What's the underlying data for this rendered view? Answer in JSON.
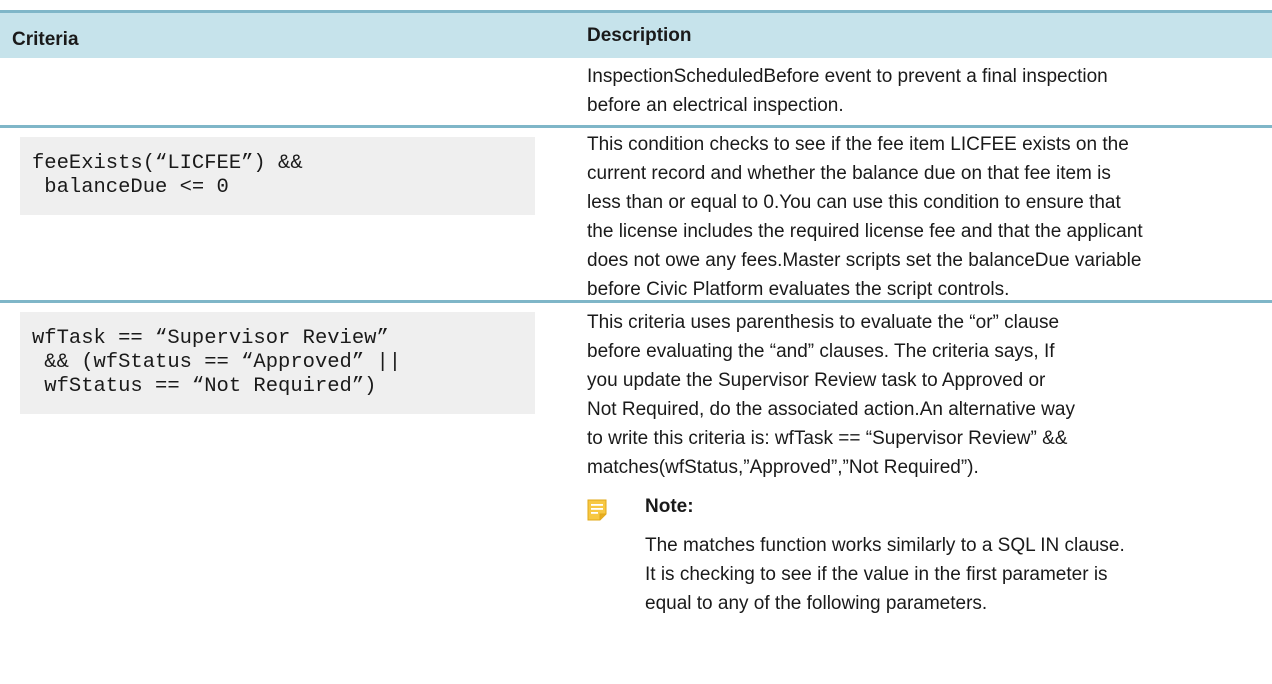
{
  "header": {
    "criteria_label": "Criteria",
    "description_label": "Description"
  },
  "rows": [
    {
      "criteria_code": "",
      "description_lines": [
        "InspectionScheduledBefore event to prevent a final inspection",
        "before an electrical inspection."
      ]
    },
    {
      "criteria_code": "feeExists(“LICFEE”) &&\n balanceDue <= 0",
      "description_lines": [
        "This condition checks to see if the fee item LICFEE exists on the",
        "current record and whether the balance due on that fee item is",
        "less than or equal to 0.You can use this condition to ensure that",
        "the license includes the required license fee and that the applicant",
        "does not owe any fees.Master scripts set the balanceDue variable",
        "before Civic Platform evaluates the script controls."
      ]
    },
    {
      "criteria_code": "wfTask == “Supervisor Review”\n && (wfStatus == “Approved” ||\n wfStatus == “Not Required”)",
      "description_lines": [
        "This criteria uses parenthesis to evaluate the “or” clause",
        "before evaluating the “and” clauses. The criteria says, If",
        "you update the Supervisor Review task to Approved or",
        "Not Required, do the associated action.An alternative way",
        "to write this criteria is: wfTask == “Supervisor Review” &&",
        "matches(wfStatus,”Approved”,”Not Required”)."
      ],
      "note": {
        "icon": "note-icon",
        "title": "Note:",
        "text_lines": [
          "The matches function works similarly to a SQL IN clause.",
          "It is checking to see if the value in the first parameter is",
          "equal to any of the following parameters."
        ]
      }
    }
  ],
  "colors": {
    "header_bg": "#c6e3eb",
    "rule": "#7fb6c8",
    "code_bg": "#efefef",
    "note_icon": "#f2b61c"
  }
}
